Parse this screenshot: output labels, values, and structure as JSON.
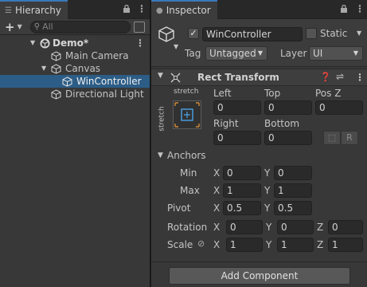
{
  "hierarchy": {
    "tab_label": "Hierarchy",
    "search_placeholder": "All",
    "items": [
      {
        "label": "Demo*",
        "icon": "unity-scene-icon",
        "level": 0
      },
      {
        "label": "Main Camera",
        "icon": "gameobject-cube-icon",
        "level": 1
      },
      {
        "label": "Canvas",
        "icon": "gameobject-cube-icon",
        "level": 1
      },
      {
        "label": "WinController",
        "icon": "gameobject-cube-icon",
        "level": 2,
        "selected": true
      },
      {
        "label": "Directional Light",
        "icon": "gameobject-cube-icon",
        "level": 1
      }
    ]
  },
  "inspector": {
    "tab_label": "Inspector",
    "object_name": "WinController",
    "active_checked": true,
    "static_label": "Static",
    "tag_label": "Tag",
    "tag_value": "Untagged",
    "layer_label": "Layer",
    "layer_value": "UI",
    "rect_transform": {
      "title": "Rect Transform",
      "anchor_preset_top": "stretch",
      "anchor_preset_side": "stretch",
      "left_label": "Left",
      "left_value": "0",
      "top_label": "Top",
      "top_value": "0",
      "posz_label": "Pos Z",
      "posz_value": "0",
      "right_label": "Right",
      "right_value": "0",
      "bottom_label": "Bottom",
      "bottom_value": "0",
      "raw_button_label": "R",
      "anchors_label": "Anchors",
      "min_label": "Min",
      "min_x": "0",
      "min_y": "0",
      "max_label": "Max",
      "max_x": "1",
      "max_y": "1",
      "pivot_label": "Pivot",
      "pivot_x": "0.5",
      "pivot_y": "0.5",
      "rotation_label": "Rotation",
      "rot_x": "0",
      "rot_y": "0",
      "rot_z": "0",
      "scale_label": "Scale",
      "scale_x": "1",
      "scale_y": "1",
      "scale_z": "1",
      "x_label": "X",
      "y_label": "Y",
      "z_label": "Z"
    },
    "add_component_label": "Add Component"
  },
  "colors": {
    "selection": "#2c5d87",
    "panel_bg": "#383838",
    "tab_accent": "#3a79bb"
  }
}
